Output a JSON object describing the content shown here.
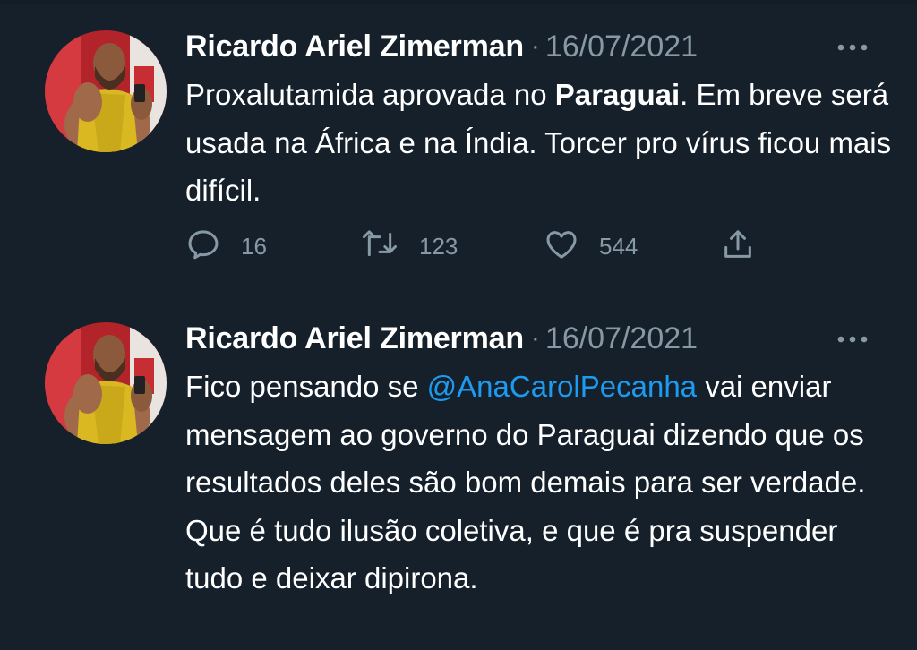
{
  "tweets": [
    {
      "author": "Ricardo Ariel Zimerman",
      "separator": "·",
      "date": "16/07/2021",
      "more_icon": "more-dots-icon",
      "text_parts": {
        "before": "Proxalutamida aprovada no ",
        "bold": "Paraguai",
        "after": ". Em breve será usada na África e na Índia. Torcer pro vírus ficou mais difícil."
      },
      "actions": {
        "reply": {
          "icon": "reply-icon",
          "count": "16"
        },
        "retweet": {
          "icon": "retweet-icon",
          "count": "123"
        },
        "like": {
          "icon": "heart-icon",
          "count": "544"
        },
        "share": {
          "icon": "share-icon"
        }
      }
    },
    {
      "author": "Ricardo Ariel Zimerman",
      "separator": "·",
      "date": "16/07/2021",
      "more_icon": "more-dots-icon",
      "text_parts": {
        "before": "Fico pensando se ",
        "mention": "@AnaCarolPecanha",
        "after": " vai enviar mensagem ao governo do Paraguai dizendo que os resultados deles são bom demais para ser verdade. Que é tudo ilusão coletiva, e que é pra suspender tudo e deixar dipirona."
      }
    }
  ],
  "colors": {
    "background": "#15202b",
    "muted": "#8899a6",
    "link": "#1d9bf0",
    "divider": "#38444d"
  }
}
